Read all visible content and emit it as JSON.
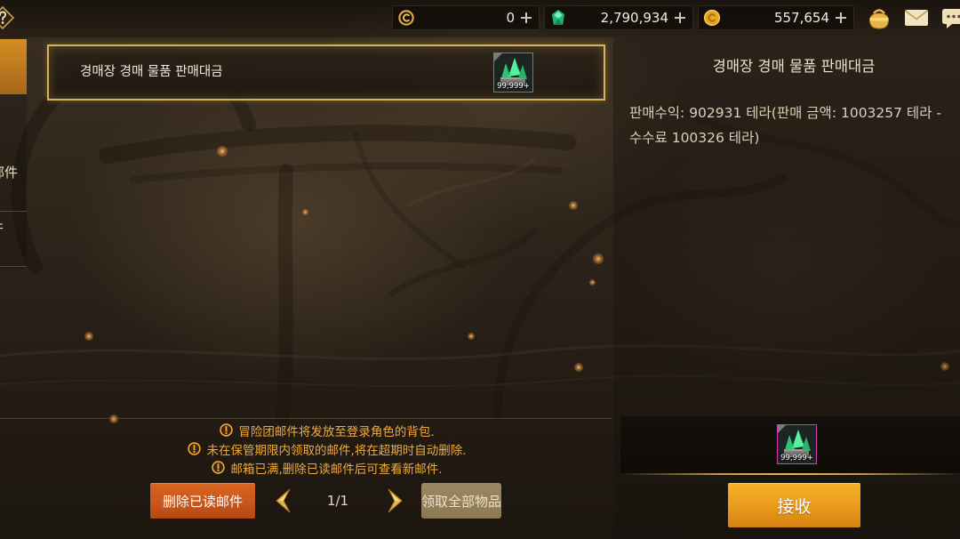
{
  "theme": {
    "accent_gold": "#d8b25a",
    "notice_orange": "#f0aa38",
    "delete_button": "#c9571b",
    "claim_all_button": "#8c7852",
    "receive_button": "#eb9c1c",
    "item_border": "#d23fb0"
  },
  "top_bar": {
    "help_icon": "help-icon",
    "currencies": [
      {
        "icon": "coin-ring-icon",
        "value": "0"
      },
      {
        "icon": "green-gem-icon",
        "value": "2,790,934"
      },
      {
        "icon": "gold-coin-icon",
        "value": "557,654"
      }
    ],
    "add_icon": "plus-icon",
    "right_icons": [
      "pouch-icon",
      "mail-icon",
      "chat-icon"
    ]
  },
  "sidebar": {
    "items": [
      {
        "active": true
      },
      {
        "label": "邮件"
      },
      {
        "label": "件"
      }
    ]
  },
  "mail_list": {
    "items": [
      {
        "title": "경매장 경매 물품 판매대금",
        "selected": true,
        "attachment": {
          "icon": "green-crystal-icon",
          "count": "99,999+"
        }
      }
    ]
  },
  "notices": {
    "icon": "exclamation-icon",
    "lines": [
      "冒险团邮件将发放至登录角色的背包.",
      "未在保管期限内领取的邮件,将在超期时自动删除.",
      "邮箱已满,删除已读邮件后可查看新邮件."
    ]
  },
  "footer": {
    "delete_read_label": "删除已读邮件",
    "pagination": {
      "prev_icon": "chevron-left-icon",
      "page": "1/1",
      "next_icon": "chevron-right-icon"
    },
    "claim_all_label": "领取全部物品"
  },
  "detail": {
    "title": "경매장 경매 물품 판매대금",
    "body_lines": [
      "판매수익: 902931 테라(판매 금액: 1003257 테라 -",
      "수수료 100326 테라)"
    ],
    "attachment": {
      "icon": "green-crystal-icon",
      "count": "99,999+"
    },
    "receive_label": "接收"
  }
}
